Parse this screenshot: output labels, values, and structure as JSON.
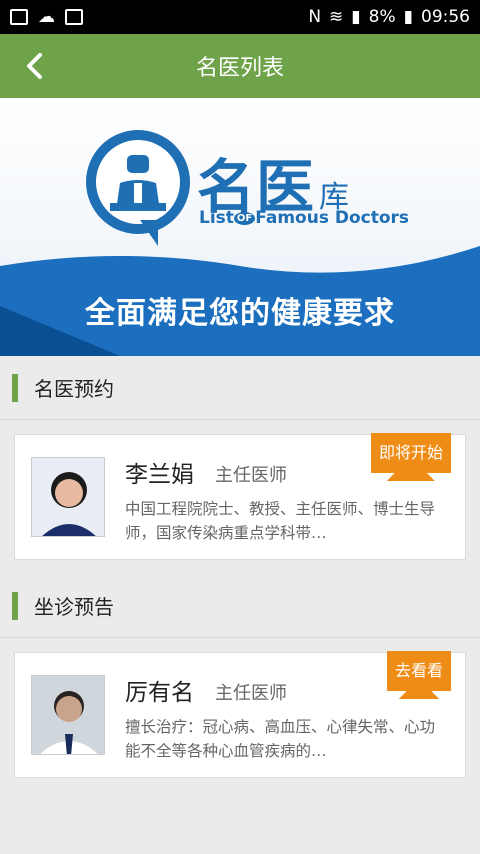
{
  "status_bar": {
    "battery": "8%",
    "time": "09:56"
  },
  "app_bar": {
    "title": "名医列表"
  },
  "banner": {
    "brand_main": "名医",
    "brand_suffix": "库",
    "brand_sub_prefix": "List",
    "brand_sub_of": "OF",
    "brand_sub_rest": "Famous Doctors",
    "slogan": "全面满足您的健康要求"
  },
  "sections": [
    {
      "label": "名医预约",
      "doctor": {
        "name": "李兰娟",
        "role": "主任医师",
        "badge": "即将开始",
        "desc": "中国工程院院士、教授、主任医师、博士生导师，国家传染病重点学科带…"
      }
    },
    {
      "label": "坐诊预告",
      "doctor": {
        "name": "厉有名",
        "role": "主任医师",
        "badge": "去看看",
        "desc": "擅长治疗：冠心病、高血压、心律失常、心功能不全等各种心血管疾病的…"
      }
    }
  ],
  "colors": {
    "accent": "#6fa34a",
    "badge": "#ef8c16",
    "brand": "#1f6fb5"
  }
}
